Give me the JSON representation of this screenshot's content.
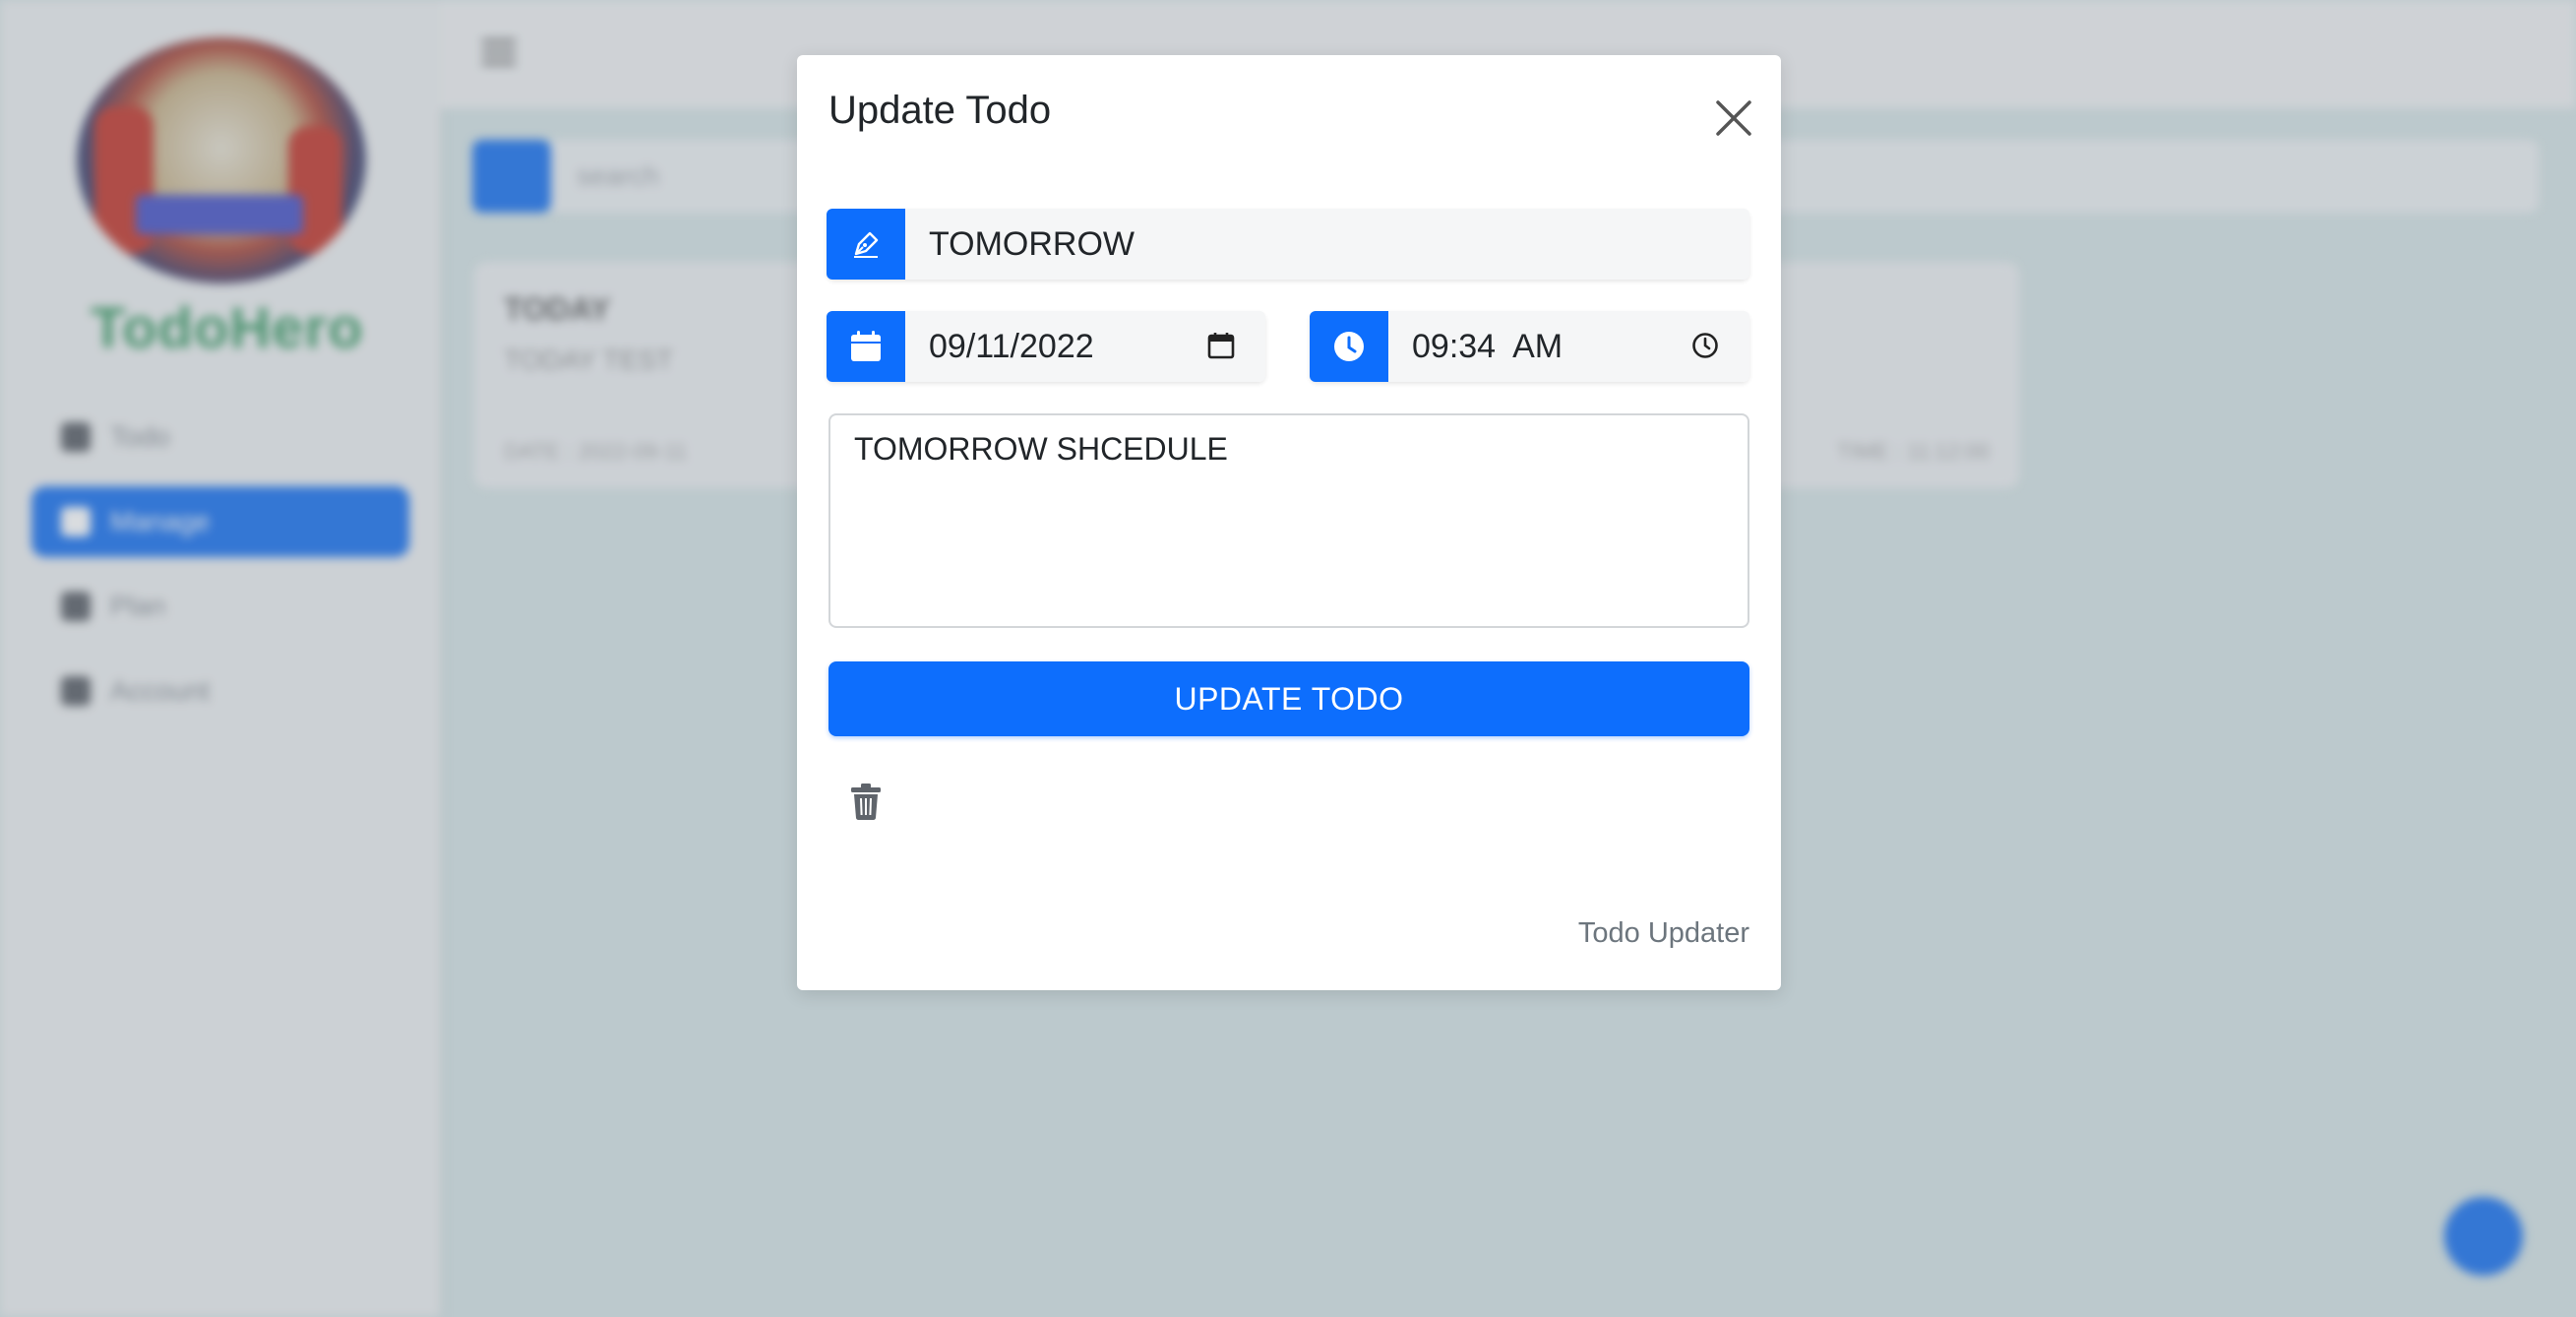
{
  "background": {
    "brand": "TodoHero",
    "nav": [
      {
        "label": "Todo"
      },
      {
        "label": "Manage"
      },
      {
        "label": "Plan"
      },
      {
        "label": "Account"
      }
    ],
    "search_placeholder": "search",
    "card": {
      "title": "TODAY",
      "subtitle": "TODAY TEST",
      "meta_left": "DATE : 2022-09-11",
      "meta_right": "TIME : 11:12:00"
    }
  },
  "modal": {
    "title": "Update Todo",
    "title_field": "TOMORROW",
    "date_field": "09/11/2022",
    "time_field": "09:34  AM",
    "description": "TOMORROW SHCEDULE",
    "submit_label": "UPDATE TODO",
    "footer": "Todo Updater"
  },
  "colors": {
    "accent": "#0d6efd",
    "brand_green": "#3f9c67"
  },
  "icons": {
    "close": "close-icon",
    "title": "pen-icon",
    "date": "calendar-icon",
    "time": "clock-icon",
    "delete": "trash-icon"
  }
}
